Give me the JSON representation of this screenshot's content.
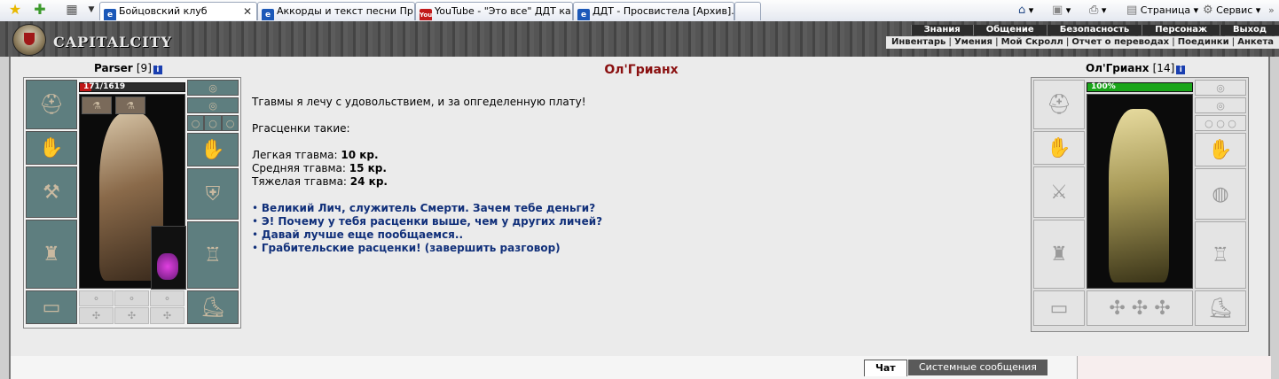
{
  "browser": {
    "tabs": [
      {
        "label": "Бойцовский клуб",
        "active": true
      },
      {
        "label": "Аккорды и текст песни Пр...",
        "active": false
      },
      {
        "label": "YouTube - \"Это все\" ДДТ ка...",
        "active": false
      },
      {
        "label": "ДДТ - Просвистела [Архив]...",
        "active": false
      }
    ],
    "youtube_favicon": "You",
    "toolbar": {
      "page": "Страница",
      "service": "Сервис"
    }
  },
  "game": {
    "logo": "CAPITALCITY",
    "nav_top": [
      "Знания",
      "Общение",
      "Безопасность",
      "Персонаж",
      "Выход"
    ],
    "nav_bottom": [
      "Инвентарь",
      "Умения",
      "Мой Скролл",
      "Отчет о переводах",
      "Поединки",
      "Анкета"
    ]
  },
  "player": {
    "name": "Parser",
    "level": "[9]",
    "info": "i",
    "hp": "171/1619",
    "hp_fraction": 0.106
  },
  "npc": {
    "name": "Ол'Грианх",
    "level": "[14]",
    "info": "i",
    "hp": "100%",
    "hp_fraction": 1.0
  },
  "dialog": {
    "title": "Ол'Грианх",
    "intro": "Тгавмы я лечу с удовольствием, и за опгеделенную плату!",
    "prices_header": "Ргасценки такие:",
    "prices": [
      {
        "label": "Легкая тгавма:",
        "value": "10 кр."
      },
      {
        "label": "Средняя тгавма:",
        "value": "15 кр."
      },
      {
        "label": "Тяжелая тгавма:",
        "value": "24 кр."
      }
    ],
    "options": [
      "Великий Лич, служитель Смерти. Зачем тебе деньги?",
      "Э! Почему у тебя расценки выше, чем у других личей?",
      "Давай лучше еще пообщаемся..",
      "Грабительские расценки! (завершить разговор)"
    ]
  },
  "chat": {
    "tabs": [
      "Чат",
      "Системные сообщения"
    ]
  }
}
